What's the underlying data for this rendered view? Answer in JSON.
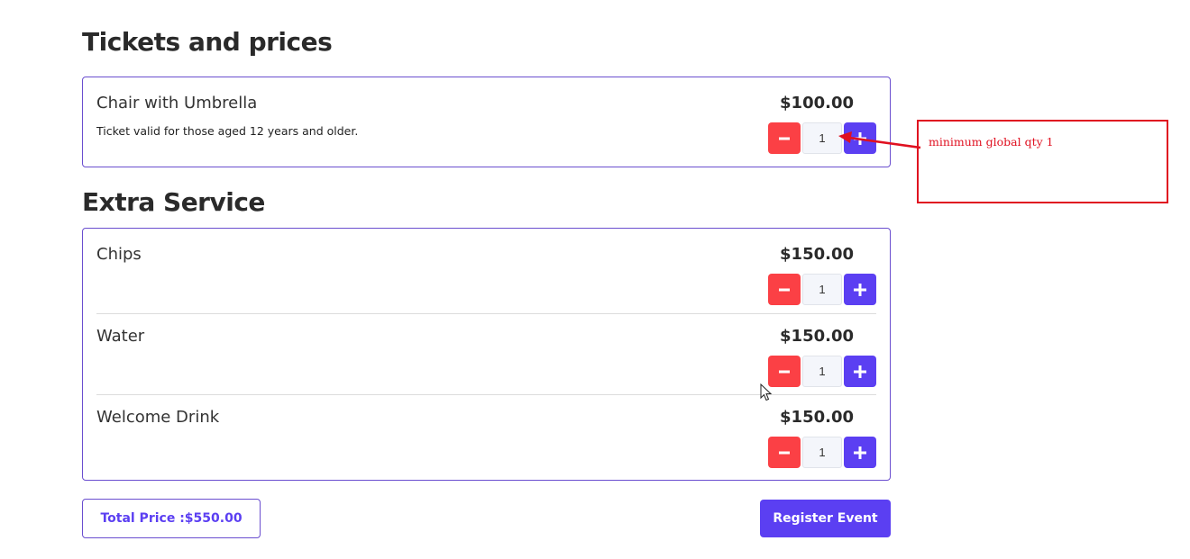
{
  "tickets": {
    "title": "Tickets and prices",
    "items": [
      {
        "name": "Chair with Umbrella",
        "description": "Ticket valid for those aged 12 years and older.",
        "price": "$100.00",
        "qty": "1"
      }
    ]
  },
  "extras": {
    "title": "Extra Service",
    "items": [
      {
        "name": "Chips",
        "price": "$150.00",
        "qty": "1"
      },
      {
        "name": "Water",
        "price": "$150.00",
        "qty": "1"
      },
      {
        "name": "Welcome Drink",
        "price": "$150.00",
        "qty": "1"
      }
    ]
  },
  "footer": {
    "total_label": "Total Price :$550.00",
    "register_label": "Register Event"
  },
  "annotation": {
    "note": "minimum global qty 1"
  },
  "colors": {
    "accent": "#5b3ff2",
    "minus": "#fb4045",
    "annotation": "#e01020"
  },
  "icons": {
    "minus": "minus-icon",
    "plus": "plus-icon",
    "cursor": "mouse-pointer-icon"
  }
}
